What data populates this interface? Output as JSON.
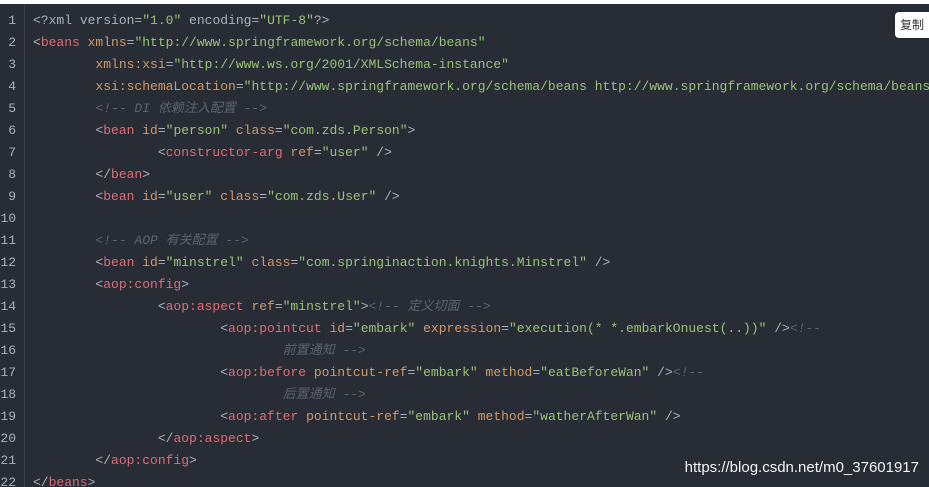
{
  "copy_button": {
    "label": "复制"
  },
  "watermark": "https://blog.csdn.net/m0_37601917",
  "colors": {
    "background": "#282c34",
    "tag": "#e06c75",
    "attribute": "#d19a66",
    "string": "#98c379",
    "comment": "#5c6370",
    "text": "#abb2bf"
  },
  "code": {
    "lines": [
      {
        "n": "1",
        "tokens": [
          [
            "pun",
            "<?"
          ],
          [
            "decl",
            "xml version="
          ],
          [
            "val",
            "\"1.0\""
          ],
          [
            "decl",
            " encoding="
          ],
          [
            "val",
            "\"UTF-8\""
          ],
          [
            "pun",
            "?>"
          ]
        ]
      },
      {
        "n": "2",
        "tokens": [
          [
            "pun",
            "<"
          ],
          [
            "tag",
            "beans"
          ],
          [
            "attr",
            " xmlns"
          ],
          [
            "pun",
            "="
          ],
          [
            "val",
            "\"http://www.springframework.org/schema/beans\""
          ]
        ]
      },
      {
        "n": "3",
        "tokens": [
          [
            "attr",
            "        xmlns:xsi"
          ],
          [
            "pun",
            "="
          ],
          [
            "val",
            "\"http://www.ws.org/2001/XMLSchema-instance\""
          ]
        ]
      },
      {
        "n": "4",
        "tokens": [
          [
            "attr",
            "        xsi:schemaLocation"
          ],
          [
            "pun",
            "="
          ],
          [
            "val",
            "\"http://www.springframework.org/schema/beans http://www.springframework.org/schema/beans/s"
          ]
        ]
      },
      {
        "n": "5",
        "tokens": [
          [
            "cm",
            "        <!-- DI 依赖注入配置 -->"
          ]
        ]
      },
      {
        "n": "6",
        "tokens": [
          [
            "pun",
            "        <"
          ],
          [
            "tag",
            "bean"
          ],
          [
            "attr",
            " id"
          ],
          [
            "pun",
            "="
          ],
          [
            "val",
            "\"person\""
          ],
          [
            "attr",
            " class"
          ],
          [
            "pun",
            "="
          ],
          [
            "val",
            "\"com.zds.Person\""
          ],
          [
            "pun",
            ">"
          ]
        ]
      },
      {
        "n": "7",
        "tokens": [
          [
            "pun",
            "                <"
          ],
          [
            "tag",
            "constructor-arg"
          ],
          [
            "attr",
            " ref"
          ],
          [
            "pun",
            "="
          ],
          [
            "val",
            "\"user\""
          ],
          [
            "pun",
            " />"
          ]
        ]
      },
      {
        "n": "8",
        "tokens": [
          [
            "pun",
            "        </"
          ],
          [
            "tag",
            "bean"
          ],
          [
            "pun",
            ">"
          ]
        ]
      },
      {
        "n": "9",
        "tokens": [
          [
            "pun",
            "        <"
          ],
          [
            "tag",
            "bean"
          ],
          [
            "attr",
            " id"
          ],
          [
            "pun",
            "="
          ],
          [
            "val",
            "\"user\""
          ],
          [
            "attr",
            " class"
          ],
          [
            "pun",
            "="
          ],
          [
            "val",
            "\"com.zds.User\""
          ],
          [
            "pun",
            " />"
          ]
        ]
      },
      {
        "n": "10",
        "tokens": []
      },
      {
        "n": "11",
        "tokens": [
          [
            "cm",
            "        <!-- AOP 有关配置 -->"
          ]
        ]
      },
      {
        "n": "12",
        "tokens": [
          [
            "pun",
            "        <"
          ],
          [
            "tag",
            "bean"
          ],
          [
            "attr",
            " id"
          ],
          [
            "pun",
            "="
          ],
          [
            "val",
            "\"minstrel\""
          ],
          [
            "attr",
            " class"
          ],
          [
            "pun",
            "="
          ],
          [
            "val",
            "\"com.springinaction.knights.Minstrel\""
          ],
          [
            "pun",
            " />"
          ]
        ]
      },
      {
        "n": "13",
        "tokens": [
          [
            "pun",
            "        <"
          ],
          [
            "tag",
            "aop:config"
          ],
          [
            "pun",
            ">"
          ]
        ]
      },
      {
        "n": "14",
        "tokens": [
          [
            "pun",
            "                <"
          ],
          [
            "tag",
            "aop:aspect"
          ],
          [
            "attr",
            " ref"
          ],
          [
            "pun",
            "="
          ],
          [
            "val",
            "\"minstrel\""
          ],
          [
            "pun",
            ">"
          ],
          [
            "cm",
            "<!-- 定义切面 -->"
          ]
        ]
      },
      {
        "n": "15",
        "tokens": [
          [
            "pun",
            "                        <"
          ],
          [
            "tag",
            "aop:pointcut"
          ],
          [
            "attr",
            " id"
          ],
          [
            "pun",
            "="
          ],
          [
            "val",
            "\"embark\""
          ],
          [
            "attr",
            " expression"
          ],
          [
            "pun",
            "="
          ],
          [
            "val",
            "\"execution(* *.embarkOnuest(..))\""
          ],
          [
            "pun",
            " />"
          ],
          [
            "cm",
            "<!--"
          ]
        ]
      },
      {
        "n": "16",
        "tokens": [
          [
            "cm",
            "                                前置通知 -->"
          ]
        ]
      },
      {
        "n": "17",
        "tokens": [
          [
            "pun",
            "                        <"
          ],
          [
            "tag",
            "aop:before"
          ],
          [
            "attr",
            " pointcut-ref"
          ],
          [
            "pun",
            "="
          ],
          [
            "val",
            "\"embark\""
          ],
          [
            "attr",
            " method"
          ],
          [
            "pun",
            "="
          ],
          [
            "val",
            "\"eatBeforeWan\""
          ],
          [
            "pun",
            " />"
          ],
          [
            "cm",
            "<!--"
          ]
        ]
      },
      {
        "n": "18",
        "tokens": [
          [
            "cm",
            "                                后置通知 -->"
          ]
        ]
      },
      {
        "n": "19",
        "tokens": [
          [
            "pun",
            "                        <"
          ],
          [
            "tag",
            "aop:after"
          ],
          [
            "attr",
            " pointcut-ref"
          ],
          [
            "pun",
            "="
          ],
          [
            "val",
            "\"embark\""
          ],
          [
            "attr",
            " method"
          ],
          [
            "pun",
            "="
          ],
          [
            "val",
            "\"watherAfterWan\""
          ],
          [
            "pun",
            " />"
          ]
        ]
      },
      {
        "n": "20",
        "tokens": [
          [
            "pun",
            "                </"
          ],
          [
            "tag",
            "aop:aspect"
          ],
          [
            "pun",
            ">"
          ]
        ]
      },
      {
        "n": "21",
        "tokens": [
          [
            "pun",
            "        </"
          ],
          [
            "tag",
            "aop:config"
          ],
          [
            "pun",
            ">"
          ]
        ]
      },
      {
        "n": "22",
        "tokens": [
          [
            "pun",
            "</"
          ],
          [
            "tag",
            "beans"
          ],
          [
            "pun",
            ">"
          ]
        ]
      }
    ]
  }
}
